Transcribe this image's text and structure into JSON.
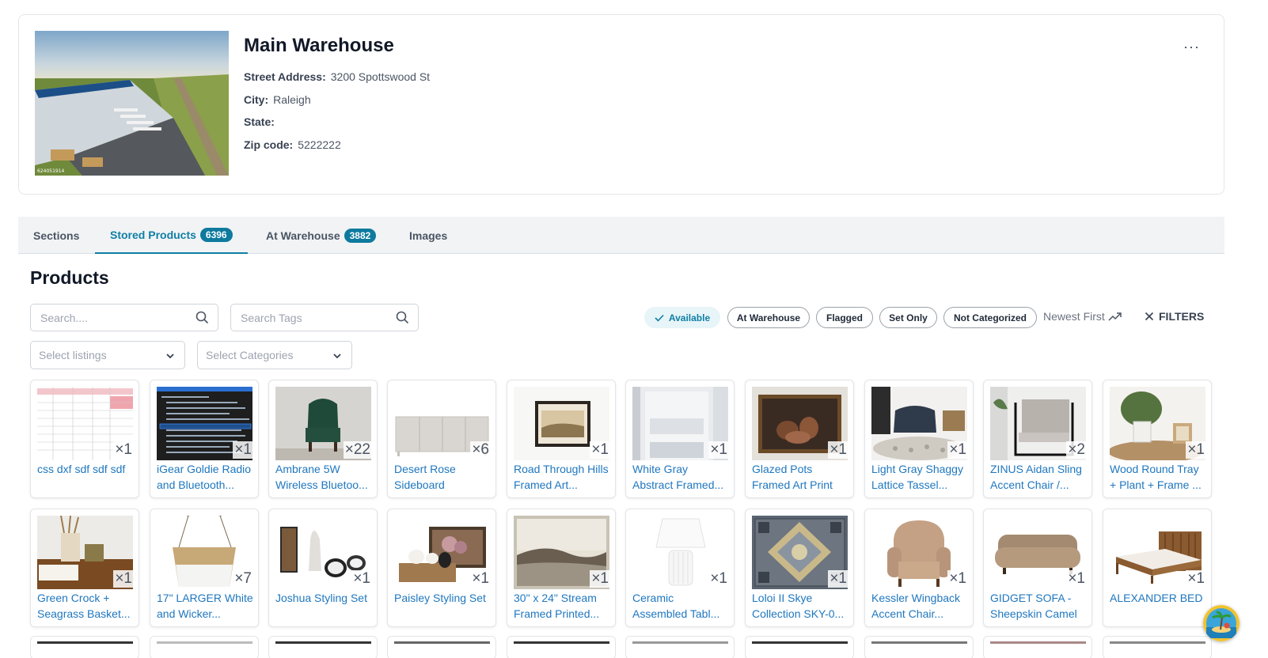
{
  "warehouse": {
    "name": "Main Warehouse",
    "photo_id": "624051914",
    "fields": [
      {
        "label": "Street Address:",
        "value": "3200 Spottswood St"
      },
      {
        "label": "City:",
        "value": "Raleigh"
      },
      {
        "label": "State:",
        "value": ""
      },
      {
        "label": "Zip code:",
        "value": "5222222"
      }
    ],
    "more_icon": "more-horizontal-icon",
    "more_label": "···"
  },
  "tabs": [
    {
      "label": "Sections",
      "badge": null,
      "active": false
    },
    {
      "label": "Stored Products",
      "badge": "6396",
      "active": true
    },
    {
      "label": "At Warehouse",
      "badge": "3882",
      "active": false
    },
    {
      "label": "Images",
      "badge": null,
      "active": false
    }
  ],
  "products": {
    "title": "Products",
    "search_placeholder": "Search....",
    "tags_placeholder": "Search Tags",
    "listings_placeholder": "Select listings",
    "categories_placeholder": "Select Categories",
    "chips": [
      "Available",
      "At Warehouse",
      "Flagged",
      "Set Only",
      "Not Categorized"
    ],
    "sort_label": "Newest First",
    "filters_label": "FILTERS",
    "colors": {
      "accent": "#0f7fa5",
      "badge": "#0e7a9e",
      "link": "#1f77bf"
    },
    "items": [
      {
        "name": "css dxf sdf sdf sdf",
        "qty": "×1"
      },
      {
        "name": "iGear Goldie Radio and Bluetooth...",
        "qty": "×1"
      },
      {
        "name": "Ambrane 5W Wireless Bluetoo...",
        "qty": "×22"
      },
      {
        "name": "Desert Rose Sideboard",
        "qty": "×6"
      },
      {
        "name": "Road Through Hills Framed Art...",
        "qty": "×1"
      },
      {
        "name": "White Gray Abstract Framed...",
        "qty": "×1"
      },
      {
        "name": "Glazed Pots Framed Art Print",
        "qty": "×1"
      },
      {
        "name": "Light Gray Shaggy Lattice Tassel...",
        "qty": "×1"
      },
      {
        "name": "ZINUS Aidan Sling Accent Chair /...",
        "qty": "×2"
      },
      {
        "name": "Wood Round Tray + Plant + Frame ...",
        "qty": "×1"
      },
      {
        "name": "Green Crock + Seagrass Basket...",
        "qty": "×1"
      },
      {
        "name": "17\" LARGER White and Wicker...",
        "qty": "×7"
      },
      {
        "name": "Joshua Styling Set",
        "qty": "×1"
      },
      {
        "name": "Paisley Styling Set",
        "qty": "×1"
      },
      {
        "name": "30\" x 24\" Stream Framed Printed...",
        "qty": "×1"
      },
      {
        "name": "Ceramic Assembled Tabl...",
        "qty": "×1"
      },
      {
        "name": "Loloi II Skye Collection SKY-0...",
        "qty": "×1"
      },
      {
        "name": "Kessler Wingback Accent Chair...",
        "qty": "×1"
      },
      {
        "name": "GIDGET SOFA - Sheepskin Camel",
        "qty": "×1"
      },
      {
        "name": "ALEXANDER BED",
        "qty": "×1"
      }
    ]
  }
}
